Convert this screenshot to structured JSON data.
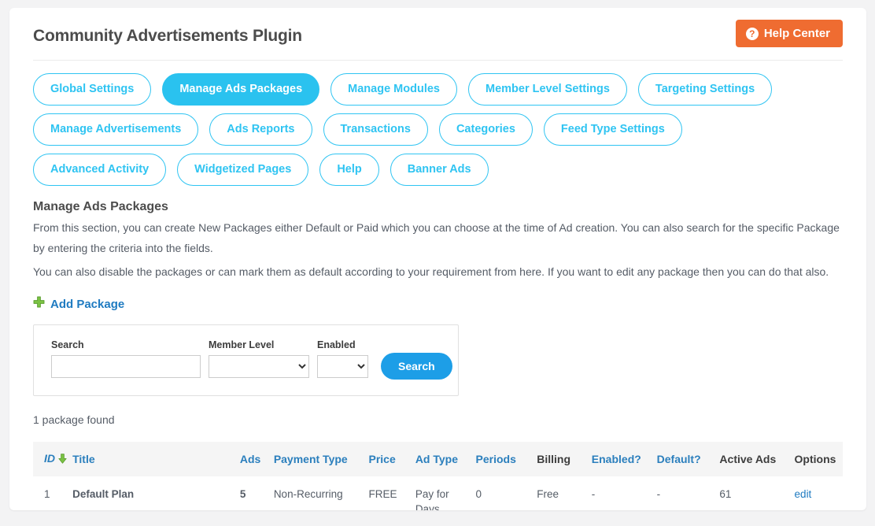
{
  "header": {
    "title": "Community Advertisements Plugin",
    "help_button_label": "Help Center",
    "help_icon_glyph": "?"
  },
  "tabs": [
    {
      "label": "Global Settings",
      "active": false
    },
    {
      "label": "Manage Ads Packages",
      "active": true
    },
    {
      "label": "Manage Modules",
      "active": false
    },
    {
      "label": "Member Level Settings",
      "active": false
    },
    {
      "label": "Targeting Settings",
      "active": false
    },
    {
      "label": "Manage Advertisements",
      "active": false
    },
    {
      "label": "Ads Reports",
      "active": false
    },
    {
      "label": "Transactions",
      "active": false
    },
    {
      "label": "Categories",
      "active": false
    },
    {
      "label": "Feed Type Settings",
      "active": false
    },
    {
      "label": "Advanced Activity",
      "active": false
    },
    {
      "label": "Widgetized Pages",
      "active": false
    },
    {
      "label": "Help",
      "active": false
    },
    {
      "label": "Banner Ads",
      "active": false
    }
  ],
  "section": {
    "title": "Manage Ads Packages",
    "desc1": "From this section, you can create New Packages either Default or Paid which you can choose at the time of Ad creation. You can also search for the specific Package by entering the criteria into the fields.",
    "desc2": "You can also disable the packages or can mark them as default according to your requirement from here. If you want to edit any package then you can do that also.",
    "add_package_label": "Add Package"
  },
  "search_form": {
    "search_label": "Search",
    "search_value": "",
    "search_placeholder": "",
    "member_level_label": "Member Level",
    "member_level_value": "",
    "enabled_label": "Enabled",
    "enabled_value": "",
    "submit_label": "Search"
  },
  "results": {
    "count_text": "1 package found",
    "columns": [
      {
        "label": "ID",
        "sortable": true,
        "sorted": true
      },
      {
        "label": "Title",
        "sortable": true
      },
      {
        "label": "Ads",
        "sortable": true
      },
      {
        "label": "Payment Type",
        "sortable": true
      },
      {
        "label": "Price",
        "sortable": true
      },
      {
        "label": "Ad Type",
        "sortable": true
      },
      {
        "label": "Periods",
        "sortable": true
      },
      {
        "label": "Billing",
        "sortable": false
      },
      {
        "label": "Enabled?",
        "sortable": true
      },
      {
        "label": "Default?",
        "sortable": true
      },
      {
        "label": "Active Ads",
        "sortable": false
      },
      {
        "label": "Options",
        "sortable": false
      }
    ],
    "rows": [
      {
        "id": "1",
        "title": "Default Plan",
        "ads": "5",
        "payment_type": "Non-Recurring",
        "price": "FREE",
        "ad_type": "Pay for Days",
        "periods": "0",
        "billing": "Free",
        "enabled": "-",
        "default": "-",
        "active_ads": "61",
        "options": "edit"
      }
    ]
  },
  "colors": {
    "accent_cyan": "#2ac2ef",
    "accent_blue": "#1d9ee7",
    "link_blue": "#1f7bc1",
    "header_blue": "#2b7fbd",
    "orange": "#ef6c31",
    "green": "#6fbe44"
  }
}
